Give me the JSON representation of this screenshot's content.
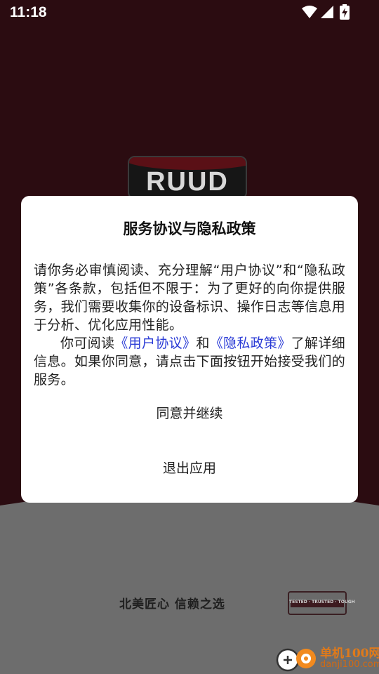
{
  "status_bar": {
    "time": "11:18"
  },
  "splash": {
    "logo_text": "RUUD",
    "slogan": "北美匠心 信赖之选",
    "badge_text": "TESTED · TRUSTED · TOUGH"
  },
  "dialog": {
    "title": "服务协议与隐私政策",
    "paragraph1": "请你务必审慎阅读、充分理解“用户协议”和“隐私政策”各条款，包括但不限于：为了更好的向你提供服务，我们需要收集你的设备标识、操作日志等信息用于分析、优化应用性能。",
    "paragraph2_prefix": "你可阅读",
    "user_agreement_link": "《用户协议》",
    "conjunction": "和",
    "privacy_policy_link": "《隐私政策》",
    "paragraph2_suffix": "了解详细信息。如果你同意，请点击下面按钮开始接受我们的服务。",
    "agree_button": "同意并继续",
    "exit_button": "退出应用"
  },
  "watermark": {
    "name": "单机100网",
    "url": "danji100.com"
  },
  "colors": {
    "link": "#2a3bd6",
    "dialog_bg": "#ffffff",
    "scrim_top": "#2b0c11",
    "scrim_bottom": "#6d6d6d",
    "watermark": "#e07a1a"
  }
}
